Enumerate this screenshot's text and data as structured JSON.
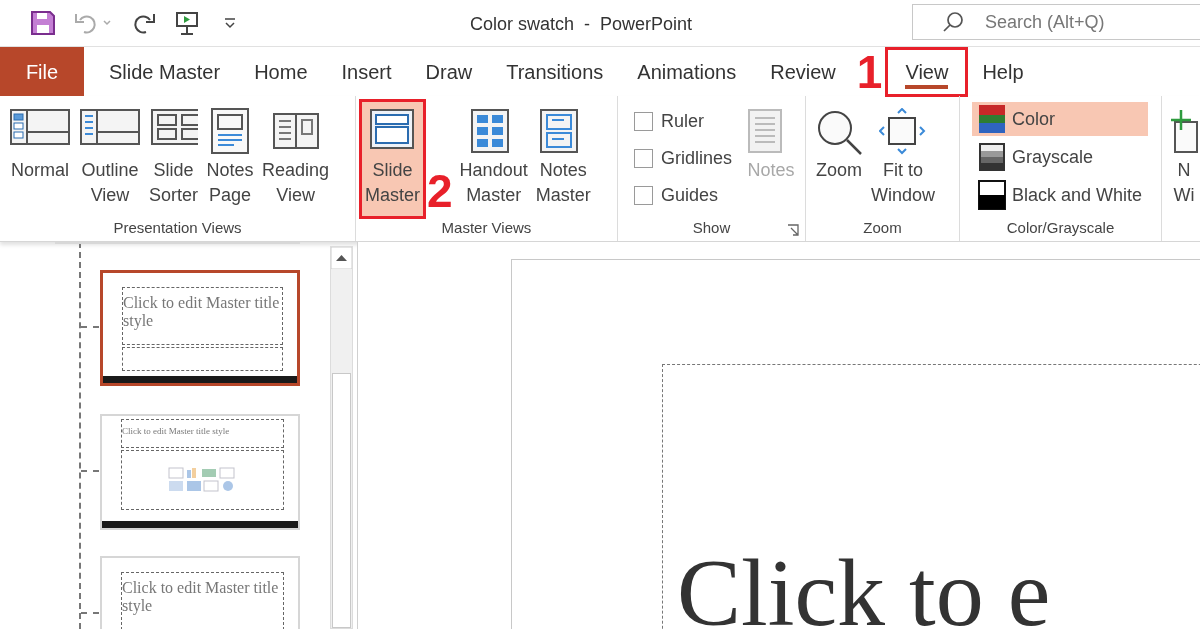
{
  "window": {
    "title": "Color swatch  -  PowerPoint"
  },
  "search": {
    "placeholder": "Search (Alt+Q)"
  },
  "tabs": [
    {
      "label": "File",
      "kind": "file",
      "selected": false,
      "outlined": false
    },
    {
      "label": "Slide Master",
      "kind": "tab",
      "selected": false,
      "outlined": false
    },
    {
      "label": "Home",
      "kind": "tab",
      "selected": false,
      "outlined": false
    },
    {
      "label": "Insert",
      "kind": "tab",
      "selected": false,
      "outlined": false
    },
    {
      "label": "Draw",
      "kind": "tab",
      "selected": false,
      "outlined": false
    },
    {
      "label": "Transitions",
      "kind": "tab",
      "selected": false,
      "outlined": false
    },
    {
      "label": "Animations",
      "kind": "tab",
      "selected": false,
      "outlined": false
    },
    {
      "label": "Review",
      "kind": "tab",
      "selected": false,
      "outlined": false
    },
    {
      "label": "View",
      "kind": "tab",
      "selected": true,
      "outlined": true
    },
    {
      "label": "Help",
      "kind": "tab",
      "selected": false,
      "outlined": false
    }
  ],
  "ribbon_groups": [
    {
      "label": "Presentation Views",
      "items": [
        {
          "kind": "large",
          "label": "Normal",
          "selected": false,
          "outlined": false
        },
        {
          "kind": "large",
          "label": "Outline\nView",
          "selected": false,
          "outlined": false
        },
        {
          "kind": "large",
          "label": "Slide\nSorter",
          "selected": false,
          "outlined": false
        },
        {
          "kind": "large",
          "label": "Notes\nPage",
          "selected": false,
          "outlined": false
        },
        {
          "kind": "large",
          "label": "Reading\nView",
          "selected": false,
          "outlined": false
        }
      ]
    },
    {
      "label": "Master Views",
      "items": [
        {
          "kind": "large",
          "label": "Slide\nMaster",
          "selected": true,
          "outlined": true
        },
        {
          "kind": "large",
          "label": "Handout\nMaster",
          "selected": false,
          "outlined": false
        },
        {
          "kind": "large",
          "label": "Notes\nMaster",
          "selected": false,
          "outlined": false
        }
      ]
    },
    {
      "label": "Show",
      "launcher": true,
      "items": [
        {
          "kind": "checkbox",
          "label": "Ruler",
          "checked": false
        },
        {
          "kind": "checkbox",
          "label": "Gridlines",
          "checked": false
        },
        {
          "kind": "checkbox",
          "label": "Guides",
          "checked": false
        },
        {
          "kind": "large",
          "label": "Notes",
          "selected": false,
          "outlined": false,
          "disabled": true
        }
      ]
    },
    {
      "label": "Zoom",
      "items": [
        {
          "kind": "large",
          "label": "Zoom",
          "selected": false,
          "outlined": false
        },
        {
          "kind": "large",
          "label": "Fit to\nWindow",
          "selected": false,
          "outlined": false
        }
      ]
    },
    {
      "label": "Color/Grayscale",
      "items": [
        {
          "kind": "mode",
          "label": "Color",
          "selected": true
        },
        {
          "kind": "mode",
          "label": "Grayscale",
          "selected": false
        },
        {
          "kind": "mode",
          "label": "Black and White",
          "selected": false
        }
      ]
    },
    {
      "items": [
        {
          "kind": "large",
          "label": "N\nWi",
          "selected": false,
          "outlined": false
        }
      ]
    }
  ],
  "thumbnails": [
    {
      "kind": "title",
      "title": "Click to edit Master title style",
      "selected": true
    },
    {
      "kind": "content",
      "title": "Click to edit Master title style",
      "selected": false
    },
    {
      "kind": "title",
      "title": "Click to edit Master title style",
      "selected": false
    }
  ],
  "slide": {
    "title": "Click to e"
  },
  "annotations": [
    {
      "label": "1"
    },
    {
      "label": "2"
    }
  ]
}
